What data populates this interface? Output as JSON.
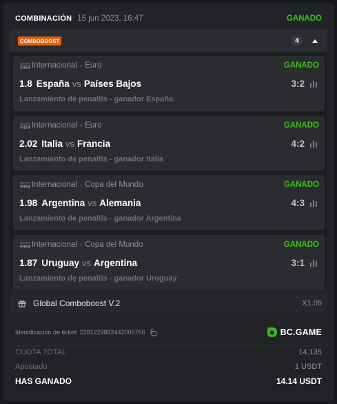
{
  "header": {
    "title": "COMBINACIÓN",
    "date": "15 jun 2023, 16:47",
    "status": "GANADO"
  },
  "combo": {
    "badge": "COMBOBOOST",
    "count": "4"
  },
  "bets": [
    {
      "category": "Internacional",
      "league": "Euro",
      "status": "GANADO",
      "odds": "1.8",
      "home": "España",
      "vs": "vs",
      "away": "Países Bajos",
      "score": "3:2",
      "market": "Lanzamiento de penaltis - ganador España"
    },
    {
      "category": "Internacional",
      "league": "Euro",
      "status": "GANADO",
      "odds": "2.02",
      "home": "Italia",
      "vs": "vs",
      "away": "Francia",
      "score": "4:2",
      "market": "Lanzamiento de penaltis - ganador Italia"
    },
    {
      "category": "Internacional",
      "league": "Copa del Mundo",
      "status": "GANADO",
      "odds": "1.98",
      "home": "Argentina",
      "vs": "vs",
      "away": "Alemania",
      "score": "4:3",
      "market": "Lanzamiento de penaltis - ganador Argentina"
    },
    {
      "category": "Internacional",
      "league": "Copa del Mundo",
      "status": "GANADO",
      "odds": "1.87",
      "home": "Uruguay",
      "vs": "vs",
      "away": "Argentina",
      "score": "3:1",
      "market": "Lanzamiento de penaltis - ganador Uruguay"
    }
  ],
  "global_boost": {
    "label": "Global Comboboost V.2",
    "multiplier": "X1.05"
  },
  "ticket": {
    "id_text": "Identificación de ticket: 2281229892442005766"
  },
  "brand": {
    "name": "BC.GAME"
  },
  "summary": {
    "total_odds_label": "CUOTA TOTAL",
    "total_odds": "14.135",
    "staked_label": "Apostado",
    "staked": "1 USDT",
    "won_label": "HAS GANADO",
    "won": "14.14 USDT"
  },
  "colors": {
    "win": "#3bc117",
    "boost": "#e8620c",
    "background": "#17181b",
    "card": "#222327"
  },
  "icons": [
    "fifa-icon",
    "stats-icon",
    "gift-icon",
    "copy-icon",
    "chevron-up-icon",
    "bc-game-logo-icon"
  ]
}
